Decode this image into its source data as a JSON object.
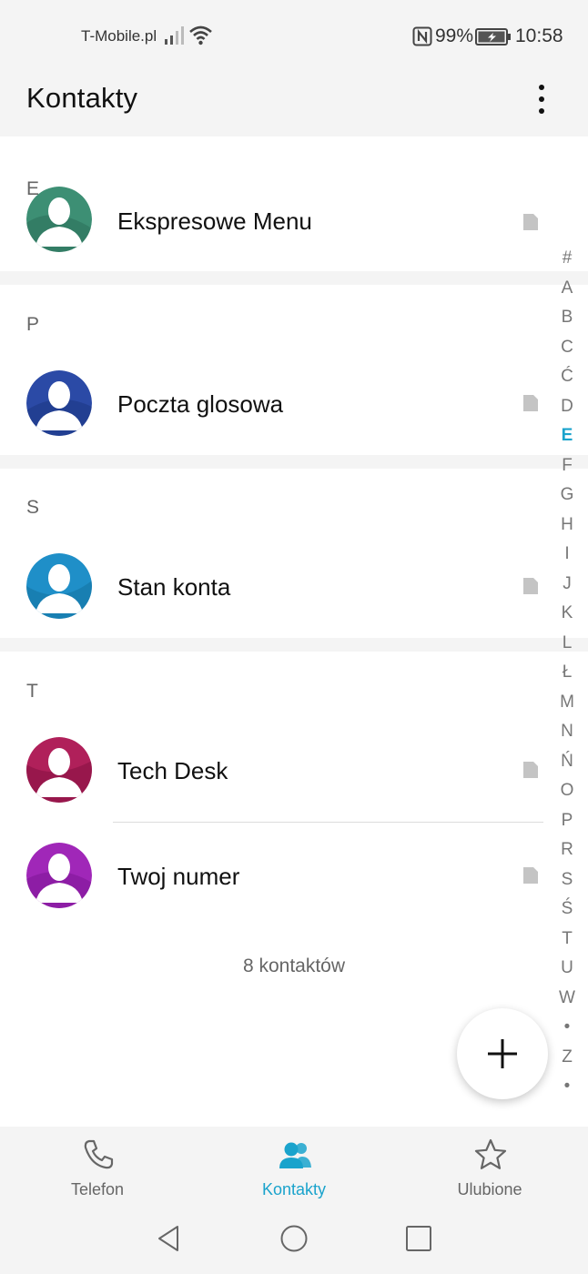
{
  "status_bar": {
    "carrier": "T-Mobile.pl",
    "battery_percent": "99%",
    "time": "10:58",
    "icons": [
      "signal-icon",
      "wifi-icon",
      "nfc-icon",
      "battery-charging-icon"
    ]
  },
  "header": {
    "title": "Kontakty",
    "menu_icon": "more-vertical-icon"
  },
  "sections": [
    {
      "letter": "E",
      "contacts": [
        {
          "name": "Ekspresowe Menu",
          "avatar_color": "#3d8f74"
        }
      ]
    },
    {
      "letter": "P",
      "contacts": [
        {
          "name": "Poczta glosowa",
          "avatar_color": "#2b4aa6"
        }
      ]
    },
    {
      "letter": "S",
      "contacts": [
        {
          "name": "Stan konta",
          "avatar_color": "#1f8fc8"
        }
      ]
    },
    {
      "letter": "T",
      "contacts": [
        {
          "name": "Tech Desk",
          "avatar_color": "#b0205a"
        },
        {
          "name": "Twoj numer",
          "avatar_color": "#a027b8"
        }
      ]
    }
  ],
  "contacts_count": "8 kontaktów",
  "alphabet_index": {
    "letters": [
      "#",
      "A",
      "B",
      "C",
      "Ć",
      "D",
      "E",
      "F",
      "G",
      "H",
      "I",
      "J",
      "K",
      "L",
      "Ł",
      "M",
      "N",
      "Ń",
      "O",
      "P",
      "R",
      "S",
      "Ś",
      "T",
      "U",
      "W",
      "•",
      "Z",
      "•"
    ],
    "active": "E",
    "active_color": "#1aa3cc"
  },
  "fab": {
    "icon": "plus-icon"
  },
  "bottom_nav": {
    "tabs": [
      {
        "label": "Telefon",
        "icon": "phone-icon",
        "active": false
      },
      {
        "label": "Kontakty",
        "icon": "contacts-icon",
        "active": true
      },
      {
        "label": "Ulubione",
        "icon": "star-icon",
        "active": false
      }
    ],
    "active_color": "#1aa3cc"
  },
  "system_nav": {
    "icons": [
      "back-icon",
      "home-icon",
      "recents-icon"
    ]
  }
}
